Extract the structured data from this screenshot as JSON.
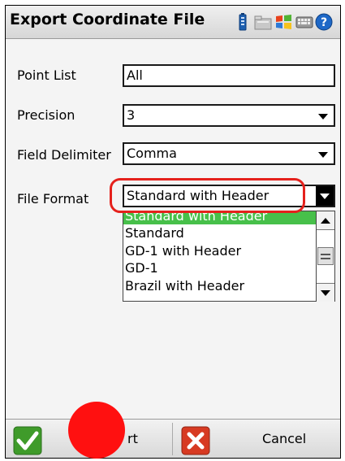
{
  "window": {
    "title": "Export Coordinate File",
    "status_icons": [
      "battery-icon",
      "folder-icon",
      "windows-flag-icon",
      "keyboard-icon",
      "help-icon"
    ]
  },
  "form": {
    "point_list": {
      "label": "Point List",
      "value": "All"
    },
    "precision": {
      "label": "Precision",
      "value": "3"
    },
    "field_delimiter": {
      "label": "Field Delimiter",
      "value": "Comma"
    },
    "file_format": {
      "label": "File Format",
      "value": "Standard with Header",
      "options": [
        "Standard with Header",
        "Standard",
        "GD-1 with Header",
        "GD-1",
        "Brazil with Header"
      ],
      "selected_index": 0
    }
  },
  "buttons": {
    "export_label": "rt",
    "cancel_label": "Cancel"
  },
  "colors": {
    "selection": "#47c04a",
    "highlight": "#e5211c",
    "marker": "#ff1010"
  }
}
